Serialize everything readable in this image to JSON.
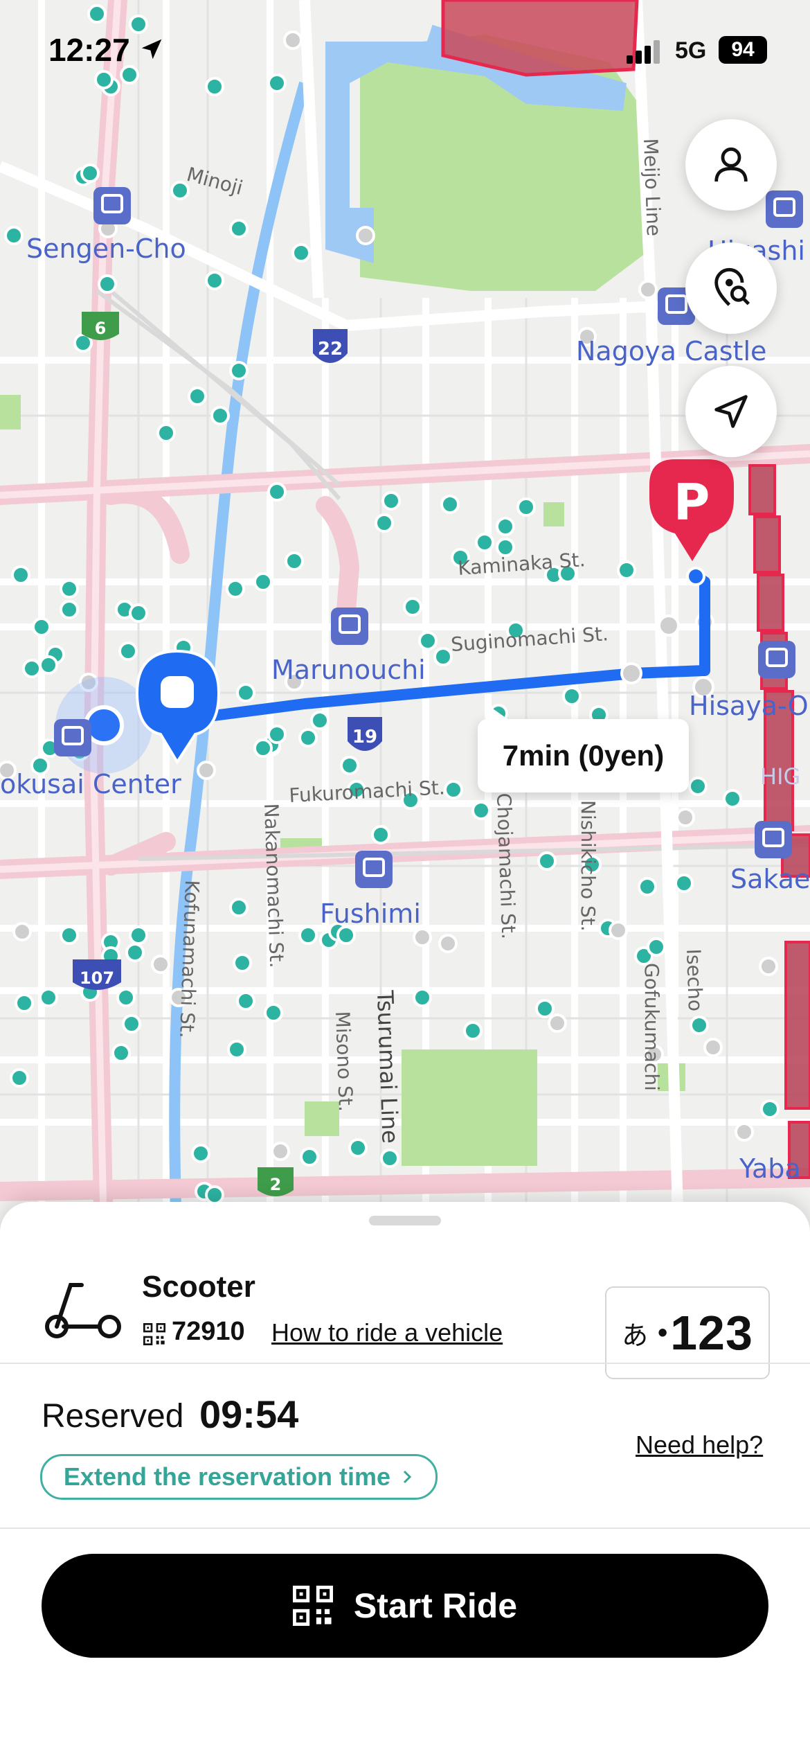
{
  "status_bar": {
    "time": "12:27",
    "network": "5G",
    "battery": "94"
  },
  "map": {
    "labels": {
      "sengen_cho": "Sengen-Cho",
      "minoji": "Minoji",
      "nagoya_castle": "Nagoya Castle",
      "hisashi": "Higashi",
      "meijo_line": "Meijo Line",
      "marunouchi": "Marunouchi",
      "kokusai_center": "okusai Center",
      "fushimi": "Fushimi",
      "hisaya": "Hisaya-O",
      "sakae": "Sakae",
      "yaba": "Yaba",
      "higashi_partial": "HIG",
      "kaminaka": "Kaminaka St.",
      "suginomachi": "Suginomachi St.",
      "fukuromachi": "Fukuromachi St.",
      "nakanomachi": "Nakanomachi St.",
      "misono": "Misono St.",
      "tsurumai": "Tsurumai Line",
      "chojamachi": "Chojamachi St.",
      "nishiki": "Nishikicho St.",
      "kofunamachi": "Kofunamachi St.",
      "isecho": "Isecho",
      "gofukumachi": "Gofukumachi"
    },
    "route_badges": {
      "r22": "22",
      "r19": "19",
      "r6": "6",
      "r107": "107",
      "r2": "2"
    },
    "parking_marker": "P",
    "route_eta": "7min (0yen)"
  },
  "vehicle": {
    "type": "Scooter",
    "id": "72910",
    "howto": "How to ride a vehicle",
    "plate_kana": "あ",
    "plate_number": "123"
  },
  "reservation": {
    "label": "Reserved",
    "time": "09:54",
    "extend": "Extend the reservation time",
    "help": "Need help?"
  },
  "action": {
    "start": "Start Ride"
  },
  "colors": {
    "accent_teal": "#35a597",
    "route_blue": "#1f6cf2",
    "parking_red": "#e6284e",
    "scooter_dot": "#2db3a1"
  }
}
